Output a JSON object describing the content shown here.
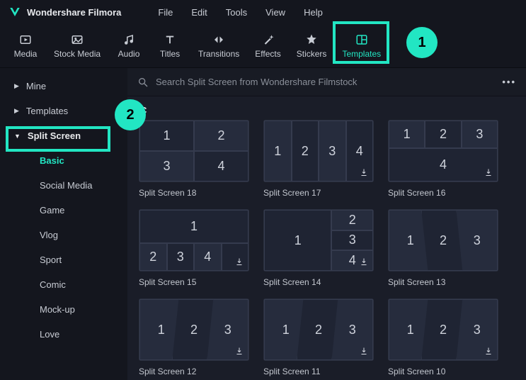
{
  "app": {
    "name": "Wondershare Filmora"
  },
  "menu": [
    "File",
    "Edit",
    "Tools",
    "View",
    "Help"
  ],
  "tools": [
    {
      "id": "media",
      "label": "Media"
    },
    {
      "id": "stock-media",
      "label": "Stock Media"
    },
    {
      "id": "audio",
      "label": "Audio"
    },
    {
      "id": "titles",
      "label": "Titles"
    },
    {
      "id": "transitions",
      "label": "Transitions"
    },
    {
      "id": "effects",
      "label": "Effects"
    },
    {
      "id": "stickers",
      "label": "Stickers"
    },
    {
      "id": "templates",
      "label": "Templates",
      "active": true
    }
  ],
  "search": {
    "placeholder": "Search Split Screen from Wondershare Filmstock"
  },
  "sidebar": {
    "items": [
      {
        "label": "Mine",
        "expanded": false
      },
      {
        "label": "Templates",
        "expanded": false
      },
      {
        "label": "Split Screen",
        "expanded": true,
        "children": [
          {
            "label": "Basic",
            "active": true
          },
          {
            "label": "Social Media"
          },
          {
            "label": "Game"
          },
          {
            "label": "Vlog"
          },
          {
            "label": "Sport"
          },
          {
            "label": "Comic"
          },
          {
            "label": "Mock-up"
          },
          {
            "label": "Love"
          }
        ]
      }
    ]
  },
  "category_band": "C",
  "templates": [
    {
      "label": "Split Screen 18",
      "layout": "g2x2"
    },
    {
      "label": "Split Screen 17",
      "layout": "row4"
    },
    {
      "label": "Split Screen 16",
      "layout": "top3-bottom1"
    },
    {
      "label": "Split Screen 15",
      "layout": "top1-bottom4"
    },
    {
      "label": "Split Screen 14",
      "layout": "left1-right3"
    },
    {
      "label": "Split Screen 13",
      "layout": "slant3b"
    },
    {
      "label": "Split Screen 12",
      "layout": "slant3a"
    },
    {
      "label": "Split Screen 11",
      "layout": "slant3a"
    },
    {
      "label": "Split Screen 10",
      "layout": "slant3a"
    }
  ],
  "annotations": {
    "badge1": "1",
    "badge2": "2"
  }
}
